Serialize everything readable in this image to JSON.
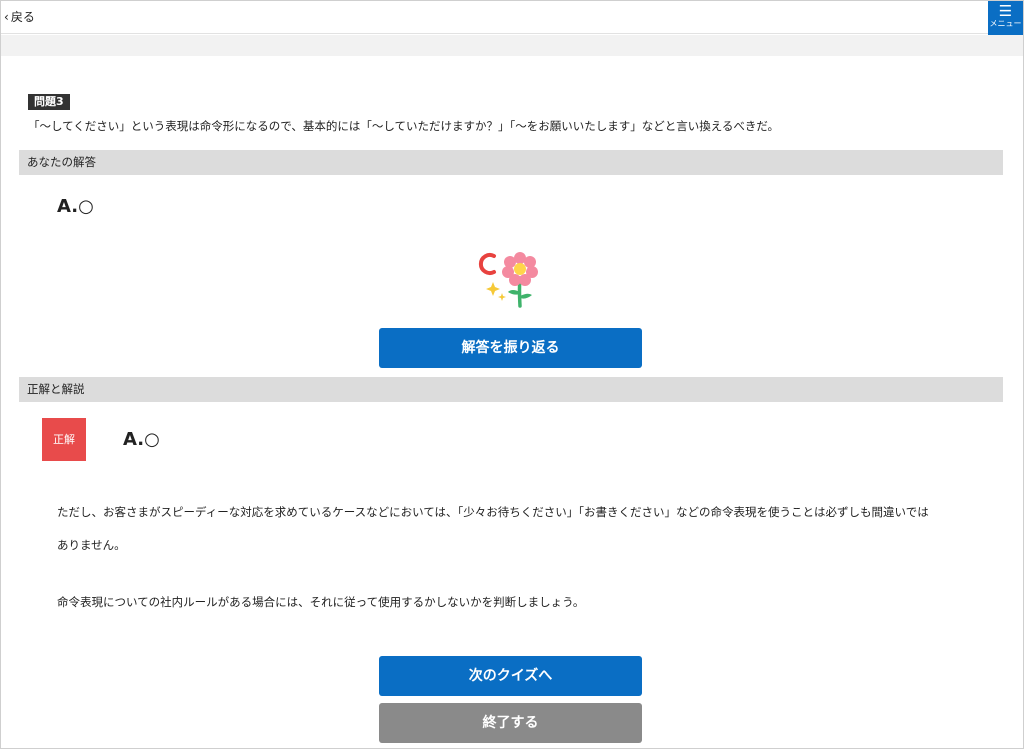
{
  "header": {
    "back_label": "戻る",
    "menu_label": "メニュー"
  },
  "question": {
    "badge": "問題3",
    "text": "「〜してください」という表現は命令形になるので、基本的には「〜していただけますか？」「〜をお願いいたします」などと言い換えるべきだ。"
  },
  "your_answer": {
    "section_title": "あなたの解答",
    "answer": "A.○"
  },
  "review_button": "解答を振り返る",
  "explanation": {
    "section_title": "正解と解説",
    "badge": "正解",
    "answer": "A.○",
    "paragraph1_line1": "ただし、お客さまがスピーディーな対応を求めているケースなどにおいては、「少々お待ちください」「お書きください」などの命令表現を使うことは必ずしも間違いでは",
    "paragraph1_line2": "ありません。",
    "paragraph2": "命令表現についての社内ルールがある場合には、それに従って使用するかしないかを判断しましょう。"
  },
  "next_button": "次のクイズへ",
  "finish_button": "終了する",
  "colors": {
    "primary": "#0a6ec4",
    "correct": "#e84b4b",
    "section_bg": "#dcdcdc",
    "gray_button": "#8a8a8a"
  }
}
